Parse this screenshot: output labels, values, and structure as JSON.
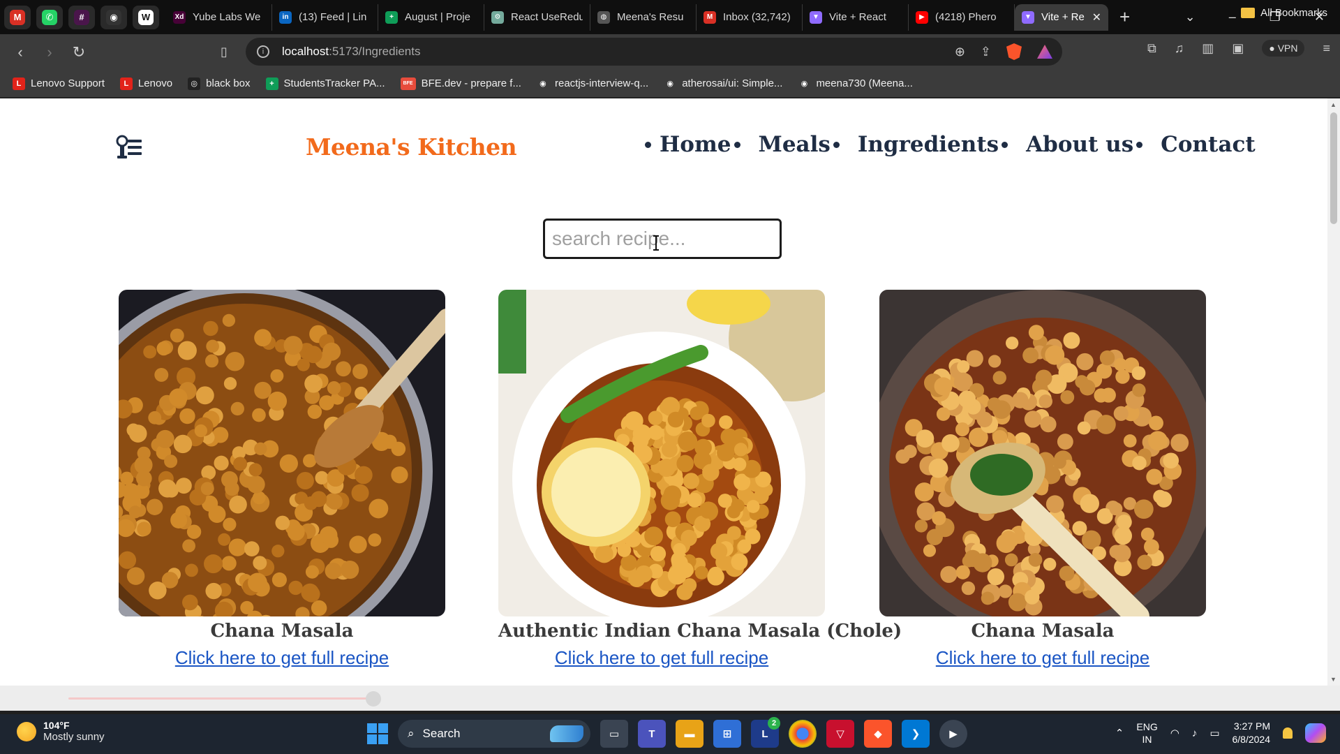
{
  "browser": {
    "pinned_tabs": [
      {
        "icon": "gmail-icon",
        "letter": "M",
        "color": "#d93025"
      },
      {
        "icon": "whatsapp-icon",
        "letter": "✆",
        "color": "#25d366"
      },
      {
        "icon": "slack-icon",
        "letter": "#",
        "color": "#4a154b"
      },
      {
        "icon": "github-icon",
        "letter": "◉",
        "color": "#333333"
      },
      {
        "icon": "wordle-icon",
        "letter": "W",
        "color": "#ffffff"
      }
    ],
    "tabs": [
      {
        "title": "Yube Labs We",
        "icon": "xd-icon",
        "color": "#470137",
        "glyph": "Xd"
      },
      {
        "title": "(13) Feed | Lin",
        "icon": "linkedin-icon",
        "color": "#0a66c2",
        "glyph": "in"
      },
      {
        "title": "August | Proje",
        "icon": "sheets-icon",
        "color": "#0f9d58",
        "glyph": "+"
      },
      {
        "title": "React UseRedu",
        "icon": "openai-icon",
        "color": "#74aa9c",
        "glyph": "⚙"
      },
      {
        "title": "Meena's Resu",
        "icon": "globe-icon",
        "color": "#555555",
        "glyph": "◍"
      },
      {
        "title": "Inbox (32,742)",
        "icon": "gmail-icon",
        "color": "#d93025",
        "glyph": "M"
      },
      {
        "title": "Vite + React",
        "icon": "vite-icon",
        "color": "#8f6bff",
        "glyph": "▼"
      },
      {
        "title": "(4218) Phero",
        "icon": "youtube-icon",
        "color": "#ff0000",
        "glyph": "▶"
      }
    ],
    "active_tab": {
      "title": "Vite + Re",
      "icon": "vite-icon",
      "color": "#8f6bff",
      "glyph": "▼"
    },
    "url_host": "localhost",
    "url_path": ":5173/Ingredients",
    "vpn_label": "VPN",
    "bookmarks": [
      {
        "label": "Lenovo Support",
        "icon": "lenovo-icon",
        "color": "#e2231a",
        "glyph": "L"
      },
      {
        "label": "Lenovo",
        "icon": "lenovo-icon",
        "color": "#e2231a",
        "glyph": "L"
      },
      {
        "label": "black box",
        "icon": "blackbox-icon",
        "color": "#222222",
        "glyph": "◎"
      },
      {
        "label": "StudentsTracker PA...",
        "icon": "sheets-icon",
        "color": "#0f9d58",
        "glyph": "+"
      },
      {
        "label": "BFE.dev - prepare f...",
        "icon": "bfe-icon",
        "color": "#e74c3c",
        "glyph": "BFE"
      },
      {
        "label": "reactjs-interview-q...",
        "icon": "github-icon",
        "color": "#3b3b3b",
        "glyph": "◉"
      },
      {
        "label": "atherosai/ui: Simple...",
        "icon": "github-icon",
        "color": "#3b3b3b",
        "glyph": "◉"
      },
      {
        "label": "meena730 (Meena...",
        "icon": "github-icon",
        "color": "#3b3b3b",
        "glyph": "◉"
      }
    ],
    "all_bookmarks": "All Bookmarks"
  },
  "site": {
    "brand": "Meena's Kitchen",
    "nav": [
      "Home",
      "Meals",
      "Ingredients",
      "About us",
      "Contact"
    ],
    "search_placeholder": "search recipe...",
    "accent": "#f26a1b",
    "nav_color": "#1f2d44",
    "recipes": [
      {
        "title": "Chana Masala",
        "link": "Click here to get full recipe"
      },
      {
        "title": "Authentic Indian Chana Masala (Chole)",
        "link": "Click here to get full recipe"
      },
      {
        "title": "Chana Masala",
        "link": "Click here to get full recipe"
      }
    ]
  },
  "taskbar": {
    "temperature": "104°F",
    "weather": "Mostly sunny",
    "search_label": "Search",
    "lang_top": "ENG",
    "lang_bottom": "IN",
    "time": "3:27 PM",
    "date": "6/8/2024",
    "badge": "2"
  }
}
